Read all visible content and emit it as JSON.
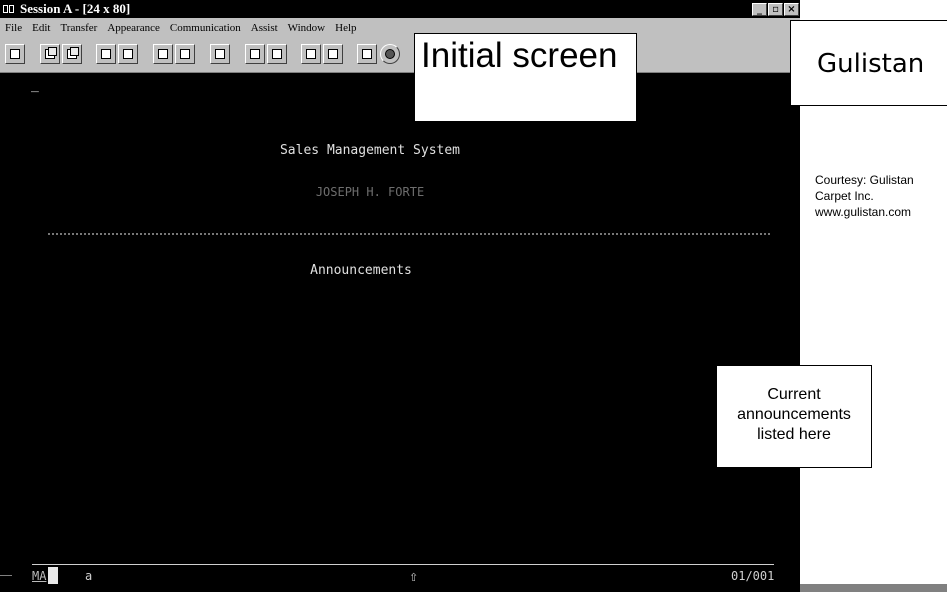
{
  "window": {
    "title": "Session A - [24 x 80]"
  },
  "window_buttons": {
    "minimize": "_",
    "maximize": "▫",
    "close": "×"
  },
  "menu": [
    "File",
    "Edit",
    "Transfer",
    "Appearance",
    "Communication",
    "Assist",
    "Window",
    "Help"
  ],
  "toolbar": {
    "buttons": [
      "print-icon",
      "copy-icon",
      "paste-icon",
      "send-icon",
      "receive-icon",
      "display-icon",
      "settings-icon",
      "edit-icon",
      "macro-icon",
      "record-icon",
      "play-icon",
      "stop-icon",
      "notes-icon",
      "globe-icon"
    ]
  },
  "terminal": {
    "cursor": "_",
    "system_title": "Sales Management System",
    "user_name": "JOSEPH H. FORTE",
    "section_heading": "Announcements"
  },
  "status_bar": {
    "mode": "MA",
    "field_indicator": "a",
    "shift_symbol": "⇧",
    "cursor_position": "01/001"
  },
  "annotations": {
    "initial_screen": "Initial screen",
    "company": "Gulistan",
    "courtesy_lines": [
      "Courtesy: Gulistan",
      "Carpet Inc.",
      "www.gulistan.com"
    ],
    "current_note": [
      "Current",
      "announcements",
      "listed here"
    ]
  }
}
